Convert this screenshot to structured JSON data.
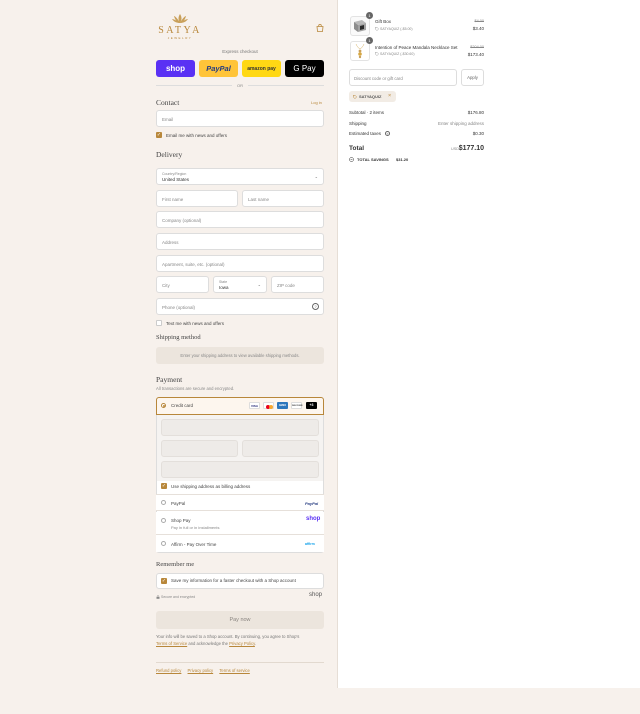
{
  "brand": {
    "name": "SATYA",
    "sub": "JEWELRY"
  },
  "express": {
    "label": "Express checkout",
    "or": "OR",
    "buttons": [
      {
        "label": "shop",
        "bg": "#5a31f4",
        "fg": "#ffffff"
      },
      {
        "label": "PayPal",
        "bg": "#ffc439",
        "fg": "#253b80"
      },
      {
        "label": "amazon pay",
        "bg": "#ffd814",
        "fg": "#333333"
      },
      {
        "label": "G Pay",
        "bg": "#000000",
        "fg": "#ffffff"
      }
    ]
  },
  "contact": {
    "title": "Contact",
    "login": "Log in",
    "email_placeholder": "Email",
    "email_news": "Email me with news and offers"
  },
  "delivery": {
    "title": "Delivery",
    "country_label": "Country/Region",
    "country_value": "United States",
    "first_name": "First name",
    "last_name": "Last name",
    "company": "Company (optional)",
    "address": "Address",
    "apartment": "Apartment, suite, etc. (optional)",
    "city": "City",
    "state_label": "State",
    "state_value": "Iowa",
    "zip": "ZIP code",
    "phone": "Phone (optional)",
    "text_news": "Text me with news and offers"
  },
  "shipping_method": {
    "title": "Shipping method",
    "message": "Enter your shipping address to view available shipping methods."
  },
  "payment": {
    "title": "Payment",
    "subtitle": "All transactions are secure and encrypted.",
    "credit_card": "Credit card",
    "card_brands": [
      "VISA",
      "MC",
      "AMEX",
      "DISCOVER",
      "+3"
    ],
    "billing_same": "Use shipping address as billing address",
    "paypal": "PayPal",
    "shop_pay": "Shop Pay",
    "shop_pay_sub": "Pay in full or in installments",
    "affirm": "Affirm - Pay Over Time",
    "paypal_logo": "PayPal",
    "shop_logo": "shop",
    "affirm_logo": "affirm"
  },
  "remember": {
    "title": "Remember me",
    "save_info": "Save my information for a faster checkout with a Shop account",
    "secure": "Secure and encrypted",
    "shop_logo": "shop"
  },
  "pay_now": "Pay now",
  "legal": {
    "text1": "Your info will be saved to a Shop account. By continuing, you agree to Shop's",
    "terms": "Terms of Service",
    "and": "and acknowledge the",
    "privacy": "Privacy Policy",
    "period": "."
  },
  "footer": [
    "Refund policy",
    "Privacy policy",
    "Terms of service"
  ],
  "cart": {
    "items": [
      {
        "qty": "1",
        "name": "Gift Box",
        "code": "SATYAQUIZ (-$5.00)",
        "old_price": "$4.00",
        "price": "$3.40"
      },
      {
        "qty": "1",
        "name": "Intention of Peace Mandala Necklace Set",
        "code": "SATYAQUIZ (-$30.60)",
        "old_price": "$204.00",
        "price": "$173.40"
      }
    ],
    "discount_placeholder": "Discount code or gift card",
    "apply": "Apply",
    "applied_code": "SATYAQUIZ",
    "subtotal_label": "Subtotal · 2 items",
    "subtotal_value": "$176.80",
    "shipping_label": "Shipping",
    "shipping_value": "Enter shipping address",
    "taxes_label": "Estimated taxes",
    "taxes_value": "$0.30",
    "total_label": "Total",
    "currency": "USD",
    "total_value": "$177.10",
    "savings_label": "TOTAL SAVINGS",
    "savings_value": "$31.20"
  }
}
